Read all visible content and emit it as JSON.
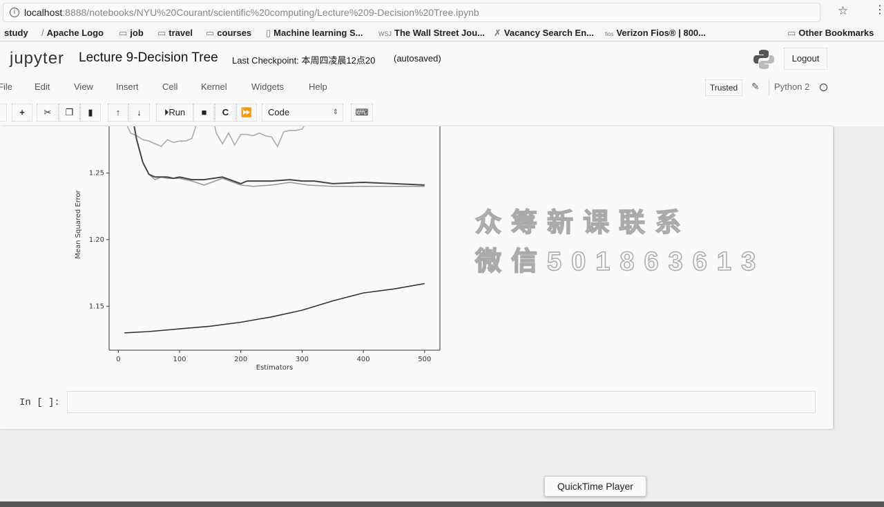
{
  "browser": {
    "url_host": "localhost",
    "url_rest": ":8888/notebooks/NYU%20Courant/scientific%20computing/Lecture%209-Decision%20Tree.ipynb",
    "bookmarks": [
      "study",
      "Apache Logo",
      "job",
      "travel",
      "courses",
      "Machine learning S...",
      "The Wall Street Jou...",
      "Vacancy Search En...",
      "Verizon Fios® | 800..."
    ],
    "other_bookmarks": "Other Bookmarks"
  },
  "header": {
    "logo": "jupyter",
    "title": "Lecture 9-Decision Tree",
    "checkpoint": "Last Checkpoint: 本周四凌晨12点20",
    "autosaved": "(autosaved)",
    "logout": "Logout"
  },
  "menu": [
    "File",
    "Edit",
    "View",
    "Insert",
    "Cell",
    "Kernel",
    "Widgets",
    "Help"
  ],
  "status": {
    "trusted": "Trusted",
    "kernel": "Python 2"
  },
  "toolbar": {
    "run": "Run",
    "cell_type": "Code"
  },
  "watermark": [
    "众筹新课联系",
    "微信501863613"
  ],
  "cell": {
    "prompt": "In [ ]:"
  },
  "tooltip": "QuickTime Player",
  "chart_data": {
    "type": "line",
    "xlabel": "Estimators",
    "ylabel": "Mean Squared Error",
    "xticks": [
      0,
      100,
      200,
      300,
      400,
      500
    ],
    "yticks": [
      "1.15",
      "1.20",
      "1.25"
    ],
    "xlim": [
      -15,
      525
    ],
    "ylim": [
      1.117,
      1.285
    ],
    "grid": false,
    "series": [
      {
        "color": "#aaaaaa",
        "x": [
          10,
          20,
          30,
          40,
          50,
          60,
          70,
          80,
          90,
          100,
          110,
          120,
          130,
          140,
          150,
          160,
          170,
          180,
          190,
          200,
          210,
          220,
          230,
          240,
          250,
          260,
          270,
          280,
          290,
          300,
          310
        ],
        "y": [
          1.29,
          1.28,
          1.278,
          1.275,
          1.274,
          1.272,
          1.27,
          1.275,
          1.273,
          1.274,
          1.274,
          1.276,
          1.29,
          1.3,
          1.3,
          1.28,
          1.272,
          1.28,
          1.271,
          1.279,
          1.279,
          1.278,
          1.28,
          1.278,
          1.277,
          1.27,
          1.281,
          1.282,
          1.282,
          1.283,
          1.29
        ]
      },
      {
        "color": "#999999",
        "x": [
          20,
          30,
          40,
          50,
          60,
          70,
          80,
          100,
          120,
          140,
          170,
          200,
          220,
          250,
          280,
          310,
          350,
          380,
          450,
          500
        ],
        "y": [
          1.3,
          1.275,
          1.258,
          1.249,
          1.245,
          1.247,
          1.246,
          1.246,
          1.244,
          1.241,
          1.246,
          1.241,
          1.24,
          1.241,
          1.243,
          1.241,
          1.24,
          1.24,
          1.24,
          1.24
        ]
      },
      {
        "color": "#444444",
        "x": [
          20,
          30,
          40,
          50,
          60,
          70,
          80,
          90,
          100,
          120,
          140,
          170,
          200,
          210,
          250,
          280,
          300,
          320,
          350,
          400,
          450,
          500
        ],
        "y": [
          1.3,
          1.275,
          1.258,
          1.249,
          1.247,
          1.247,
          1.247,
          1.246,
          1.247,
          1.245,
          1.245,
          1.247,
          1.242,
          1.244,
          1.244,
          1.245,
          1.244,
          1.244,
          1.242,
          1.243,
          1.242,
          1.241
        ]
      },
      {
        "color": "#333333",
        "x": [
          10,
          50,
          100,
          150,
          200,
          250,
          300,
          350,
          400,
          450,
          500
        ],
        "y": [
          1.13,
          1.131,
          1.133,
          1.135,
          1.138,
          1.142,
          1.147,
          1.154,
          1.16,
          1.163,
          1.167
        ]
      }
    ]
  }
}
